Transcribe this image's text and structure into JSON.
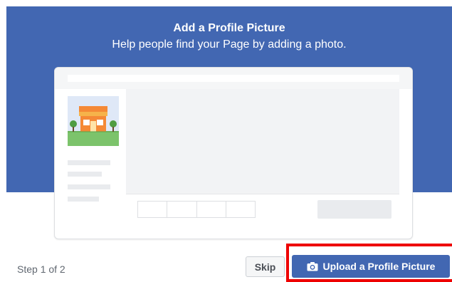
{
  "dialog": {
    "title": "Add a Profile Picture",
    "subtitle": "Help people find your Page by adding a photo."
  },
  "footer": {
    "step_text": "Step 1 of 2",
    "skip_label": "Skip",
    "upload_label": "Upload a Profile Picture"
  },
  "colors": {
    "brand_blue": "#4267b2",
    "highlight_red": "#ee0000",
    "skeleton_gray": "#e9ebee"
  },
  "icons": {
    "upload_button": "camera-icon",
    "avatar_placeholder": "storefront-icon"
  }
}
